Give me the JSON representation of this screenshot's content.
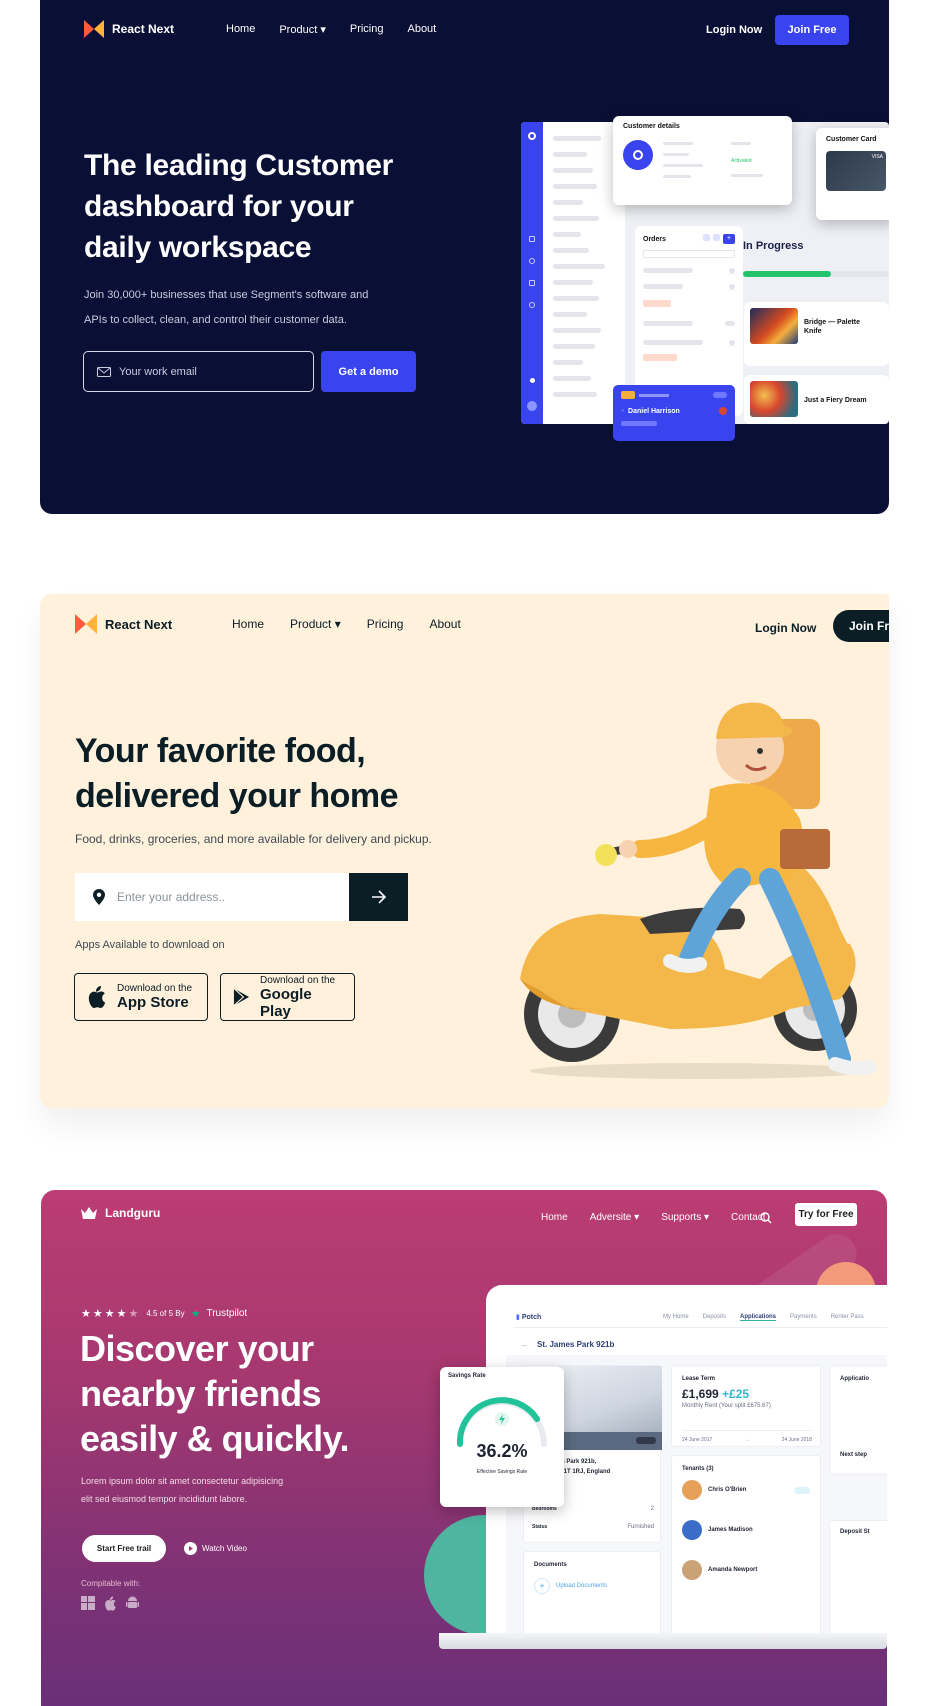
{
  "hero1": {
    "brand": "React Next",
    "nav": [
      "Home",
      "Product",
      "Pricing",
      "About"
    ],
    "login": "Login Now",
    "join": "Join Free",
    "headline": [
      "The leading Customer",
      "dashboard for your",
      "daily workspace"
    ],
    "subtext": [
      "Join 30,000+ businesses that use Segment's software and",
      "APIs to collect, clean, and control their customer data."
    ],
    "email_placeholder": "Your work email",
    "demo_button": "Get a demo",
    "dashboard": {
      "customer_details": "Customer details",
      "customer_card": "Customer Card",
      "orders": "Orders",
      "in_progress": "In Progress",
      "item1": [
        "Bridge — Palette",
        "Knife"
      ],
      "item2": "Just a Fiery Dream",
      "person": "Daniel Harrison",
      "card_brand": "VISA",
      "status": "Activated"
    }
  },
  "hero2": {
    "brand": "React Next",
    "nav": [
      "Home",
      "Product",
      "Pricing",
      "About"
    ],
    "login": "Login Now",
    "join": "Join Free",
    "headline": [
      "Your favorite food,",
      "delivered your home"
    ],
    "subtext": "Food, drinks, groceries, and more available for delivery and pickup.",
    "address_placeholder": "Enter your address..",
    "apps_label": "Apps Available to download on",
    "app_store": {
      "small": "Download on the",
      "big": "App Store"
    },
    "google_play": {
      "small": "Download on the",
      "big": "Google Play"
    }
  },
  "hero3": {
    "brand": "Landguru",
    "nav": [
      "Home",
      "Adversite",
      "Supports",
      "Contact"
    ],
    "try_button": "Try for Free",
    "rating": "4.5 of 5 By",
    "trustpilot": "Trustpilot",
    "headline": [
      "Discover your",
      "nearby friends",
      "easily & quickly."
    ],
    "subtext": [
      "Lorem ipsum dolor sit amet consectetur adipisicing",
      "elit sed eiusmod tempor incididunt labore."
    ],
    "start_button": "Start Free trail",
    "watch": "Watch Video",
    "compatible": "Compitable with:",
    "app": {
      "brand": "Potch",
      "tabs": [
        "My Home",
        "Deposits",
        "Applications",
        "Payments",
        "Renter Pass"
      ],
      "address": "St. James Park 921b",
      "savings_label": "Savings Rate",
      "savings_value": "36.2%",
      "savings_caption": "Effective Savings Rate",
      "lease_label": "Lease Term",
      "price": "£1,699",
      "price_extra": "+£25",
      "rent_caption": "Monthly Rent (Your split £675.67)",
      "date_start": "24 June 2017",
      "date_end": "24 June 2018",
      "tenants_label": "Tenants (3)",
      "tenants": [
        "Chris O'Brien",
        "James Madison",
        "Amanda Newport"
      ],
      "property_lines": [
        "es Park 921b,",
        "W1T 1RJ, England"
      ],
      "rows": [
        "Bedrooms",
        "Status"
      ],
      "row_values": [
        "2",
        "Furnished"
      ],
      "documents": "Documents",
      "upload": "Upload Documents",
      "application": "Applicatio",
      "next_step": "Next step",
      "deposit": "Deposit St"
    }
  }
}
